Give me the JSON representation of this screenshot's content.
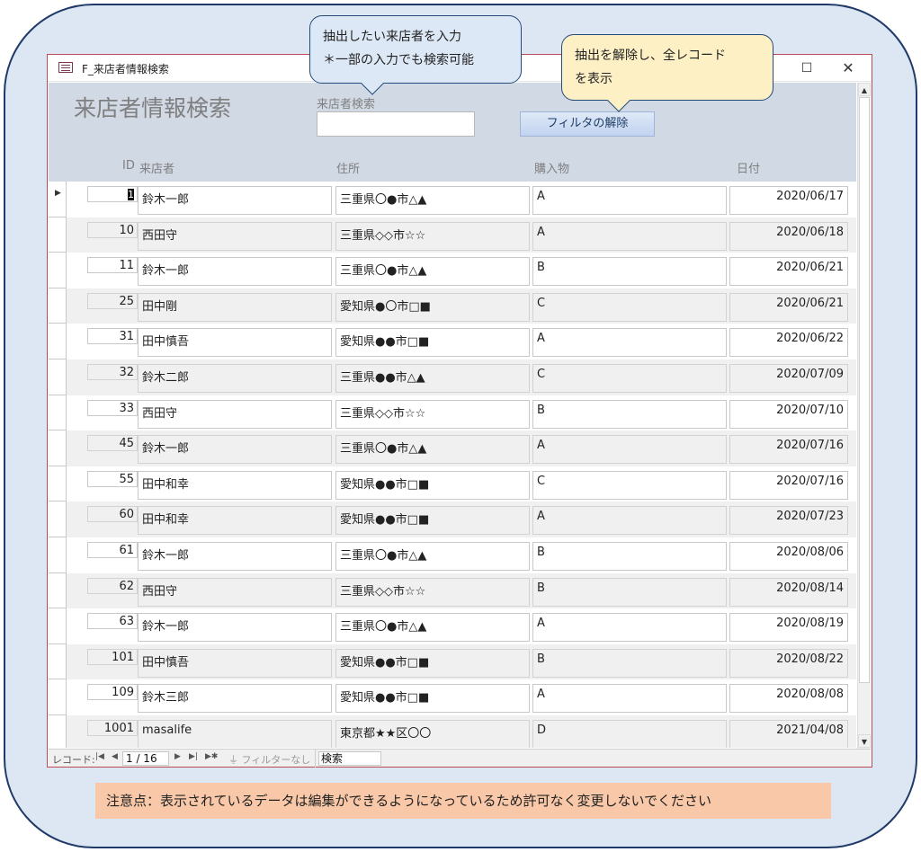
{
  "window": {
    "title": "F_来店者情報検索",
    "maximize_glyph": "☐",
    "close_glyph": "✕"
  },
  "form": {
    "title": "来店者情報検索",
    "search_label": "来店者検索",
    "search_value": "",
    "filter_button_label": "フィルタの解除"
  },
  "columns": {
    "id": "ID",
    "name": "来店者",
    "address": "住所",
    "item": "購入物",
    "date": "日付"
  },
  "rows": [
    {
      "id": "1",
      "name": "鈴木一郎",
      "address": "三重県〇●市△▲",
      "item": "A",
      "date": "2020/06/17"
    },
    {
      "id": "10",
      "name": "西田守",
      "address": "三重県◇◇市☆☆",
      "item": "A",
      "date": "2020/06/18"
    },
    {
      "id": "11",
      "name": "鈴木一郎",
      "address": "三重県〇●市△▲",
      "item": "B",
      "date": "2020/06/21"
    },
    {
      "id": "25",
      "name": "田中剛",
      "address": "愛知県●〇市□■",
      "item": "C",
      "date": "2020/06/21"
    },
    {
      "id": "31",
      "name": "田中慎吾",
      "address": "愛知県●●市□■",
      "item": "A",
      "date": "2020/06/22"
    },
    {
      "id": "32",
      "name": "鈴木二郎",
      "address": "三重県●●市△▲",
      "item": "C",
      "date": "2020/07/09"
    },
    {
      "id": "33",
      "name": "西田守",
      "address": "三重県◇◇市☆☆",
      "item": "B",
      "date": "2020/07/10"
    },
    {
      "id": "45",
      "name": "鈴木一郎",
      "address": "三重県〇●市△▲",
      "item": "A",
      "date": "2020/07/16"
    },
    {
      "id": "55",
      "name": "田中和幸",
      "address": "愛知県●●市□■",
      "item": "C",
      "date": "2020/07/16"
    },
    {
      "id": "60",
      "name": "田中和幸",
      "address": "愛知県●●市□■",
      "item": "A",
      "date": "2020/07/23"
    },
    {
      "id": "61",
      "name": "鈴木一郎",
      "address": "三重県〇●市△▲",
      "item": "B",
      "date": "2020/08/06"
    },
    {
      "id": "62",
      "name": "西田守",
      "address": "三重県◇◇市☆☆",
      "item": "B",
      "date": "2020/08/14"
    },
    {
      "id": "63",
      "name": "鈴木一郎",
      "address": "三重県〇●市△▲",
      "item": "A",
      "date": "2020/08/19"
    },
    {
      "id": "101",
      "name": "田中慎吾",
      "address": "愛知県●●市□■",
      "item": "B",
      "date": "2020/08/22"
    },
    {
      "id": "109",
      "name": "鈴木三郎",
      "address": "愛知県●●市□■",
      "item": "A",
      "date": "2020/08/08"
    },
    {
      "id": "1001",
      "name": "masalife",
      "address": "東京都★★区〇〇",
      "item": "D",
      "date": "2021/04/08"
    }
  ],
  "navbar": {
    "label": "レコード:",
    "first": "|◀",
    "prev": "◀",
    "position": "1 / 16",
    "next": "▶",
    "last": "▶|",
    "new": "▶✱",
    "filter_status": "フィルターなし",
    "search_value": "検索"
  },
  "callouts": {
    "search_line1": "抽出したい来店者を入力",
    "search_line2": "＊一部の入力でも検索可能",
    "filter_line1": "抽出を解除し、全レコード",
    "filter_line2": "を表示"
  },
  "notice": "注意点：表示されているデータは編集ができるようになっているため許可なく変更しないでください",
  "colors": {
    "frame_border": "#1f3a68",
    "frame_fill": "#dde6f3",
    "header_fill": "#d1d9e5",
    "callout_blue": "#dde8f6",
    "callout_yellow": "#fdf0c4",
    "notice_fill": "#f8c8a8"
  }
}
